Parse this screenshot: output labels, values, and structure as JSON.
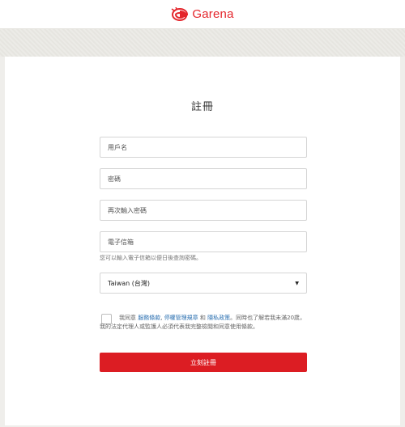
{
  "header": {
    "brand": "Garena",
    "brand_color": "#e4262c",
    "logo_icon": "garena-logo-icon"
  },
  "form": {
    "title": "註冊",
    "username_placeholder": "用戶名",
    "password_placeholder": "密碼",
    "confirm_password_placeholder": "再次輸入密碼",
    "email_placeholder": "電子信箱",
    "email_hint": "您可以輸入電子信箱以便日後查詢密碼。",
    "country_selected": "Taiwan (台灣)",
    "terms": {
      "prefix": "我同意 ",
      "link1": "服務條款",
      "sep1": ", ",
      "link2": "停權管理規章",
      "sep2": " 和 ",
      "link3": "隱私政策",
      "suffix": "。同時也了解若我未滿20歲，我的法定代理人或監護人必須代表我完整檢閱和同意使用條款。"
    },
    "submit_label": "立刻註冊",
    "submit_color": "#dc1d23"
  }
}
